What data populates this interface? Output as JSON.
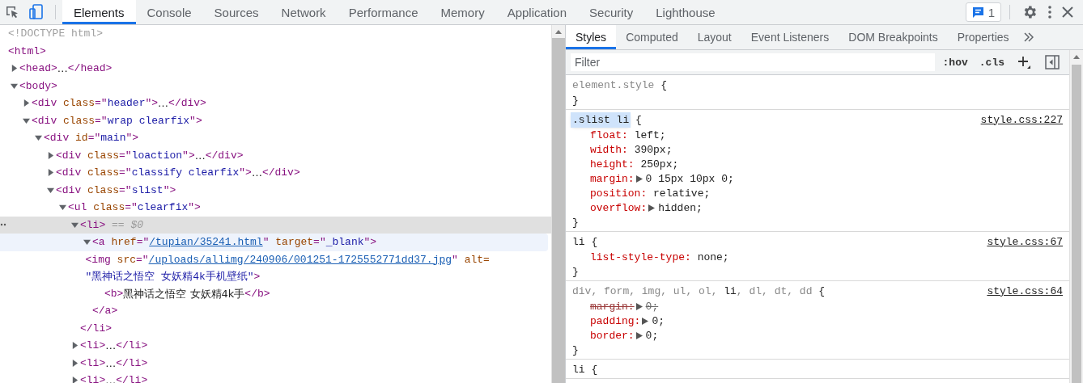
{
  "toolbar": {
    "tabs": [
      {
        "label": "Elements",
        "selected": true
      },
      {
        "label": "Console",
        "selected": false
      },
      {
        "label": "Sources",
        "selected": false
      },
      {
        "label": "Network",
        "selected": false
      },
      {
        "label": "Performance",
        "selected": false
      },
      {
        "label": "Memory",
        "selected": false
      },
      {
        "label": "Application",
        "selected": false
      },
      {
        "label": "Security",
        "selected": false
      },
      {
        "label": "Lighthouse",
        "selected": false
      }
    ],
    "issues_count": "1"
  },
  "dom_tree": [
    {
      "selected": false,
      "hovered": false,
      "segments": [
        {
          "kind": "doctype",
          "text": "<!DOCTYPE html>"
        }
      ]
    },
    {
      "selected": false,
      "hovered": false,
      "segments": [
        {
          "kind": "tag",
          "text": "<html>"
        }
      ],
      "children": [
        {
          "selected": false,
          "hovered": false,
          "expanded": false,
          "segments": [
            {
              "kind": "tag",
              "text": "<head>"
            },
            {
              "kind": "text",
              "text": "…"
            },
            {
              "kind": "tag",
              "text": "</head>"
            }
          ]
        },
        {
          "selected": false,
          "hovered": false,
          "expanded": true,
          "segments": [
            {
              "kind": "tag",
              "text": "<body>"
            }
          ],
          "children": [
            {
              "selected": false,
              "hovered": false,
              "expanded": false,
              "segments": [
                {
                  "kind": "tag",
                  "text": "<div"
                },
                {
                  "kind": "attr",
                  "text": " class"
                },
                {
                  "kind": "punct",
                  "text": "=\""
                },
                {
                  "kind": "value",
                  "text": "header"
                },
                {
                  "kind": "punct",
                  "text": "\""
                },
                {
                  "kind": "tag",
                  "text": ">"
                },
                {
                  "kind": "text",
                  "text": "…"
                },
                {
                  "kind": "tag",
                  "text": "</div>"
                }
              ]
            },
            {
              "selected": false,
              "hovered": false,
              "expanded": true,
              "segments": [
                {
                  "kind": "tag",
                  "text": "<div"
                },
                {
                  "kind": "attr",
                  "text": " class"
                },
                {
                  "kind": "punct",
                  "text": "=\""
                },
                {
                  "kind": "value",
                  "text": "wrap clearfix"
                },
                {
                  "kind": "punct",
                  "text": "\""
                },
                {
                  "kind": "tag",
                  "text": ">"
                }
              ],
              "children": [
                {
                  "selected": false,
                  "hovered": false,
                  "expanded": true,
                  "segments": [
                    {
                      "kind": "tag",
                      "text": "<div"
                    },
                    {
                      "kind": "attr",
                      "text": " id"
                    },
                    {
                      "kind": "punct",
                      "text": "=\""
                    },
                    {
                      "kind": "value",
                      "text": "main"
                    },
                    {
                      "kind": "punct",
                      "text": "\""
                    },
                    {
                      "kind": "tag",
                      "text": ">"
                    }
                  ],
                  "children": [
                    {
                      "selected": false,
                      "hovered": false,
                      "expanded": false,
                      "segments": [
                        {
                          "kind": "tag",
                          "text": "<div"
                        },
                        {
                          "kind": "attr",
                          "text": " class"
                        },
                        {
                          "kind": "punct",
                          "text": "=\""
                        },
                        {
                          "kind": "value",
                          "text": "loaction"
                        },
                        {
                          "kind": "punct",
                          "text": "\""
                        },
                        {
                          "kind": "tag",
                          "text": ">"
                        },
                        {
                          "kind": "text",
                          "text": "…"
                        },
                        {
                          "kind": "tag",
                          "text": "</div>"
                        }
                      ]
                    },
                    {
                      "selected": false,
                      "hovered": false,
                      "expanded": false,
                      "segments": [
                        {
                          "kind": "tag",
                          "text": "<div"
                        },
                        {
                          "kind": "attr",
                          "text": " class"
                        },
                        {
                          "kind": "punct",
                          "text": "=\""
                        },
                        {
                          "kind": "value",
                          "text": "classify clearfix"
                        },
                        {
                          "kind": "punct",
                          "text": "\""
                        },
                        {
                          "kind": "tag",
                          "text": ">"
                        },
                        {
                          "kind": "text",
                          "text": "…"
                        },
                        {
                          "kind": "tag",
                          "text": "</div>"
                        }
                      ]
                    },
                    {
                      "selected": false,
                      "hovered": false,
                      "expanded": true,
                      "segments": [
                        {
                          "kind": "tag",
                          "text": "<div"
                        },
                        {
                          "kind": "attr",
                          "text": " class"
                        },
                        {
                          "kind": "punct",
                          "text": "=\""
                        },
                        {
                          "kind": "value",
                          "text": "slist"
                        },
                        {
                          "kind": "punct",
                          "text": "\""
                        },
                        {
                          "kind": "tag",
                          "text": ">"
                        }
                      ],
                      "children": [
                        {
                          "selected": false,
                          "hovered": false,
                          "expanded": true,
                          "segments": [
                            {
                              "kind": "tag",
                              "text": "<ul"
                            },
                            {
                              "kind": "attr",
                              "text": " class"
                            },
                            {
                              "kind": "punct",
                              "text": "=\""
                            },
                            {
                              "kind": "value",
                              "text": "clearfix"
                            },
                            {
                              "kind": "punct",
                              "text": "\""
                            },
                            {
                              "kind": "tag",
                              "text": ">"
                            }
                          ],
                          "children": [
                            {
                              "selected": true,
                              "hovered": false,
                              "expanded": true,
                              "segments": [
                                {
                                  "kind": "tag",
                                  "text": "<li>"
                                },
                                {
                                  "kind": "marker",
                                  "text": " == $0"
                                }
                              ],
                              "close": [
                                {
                                  "kind": "tag",
                                  "text": "</li>"
                                }
                              ],
                              "children": [
                                {
                                  "selected": false,
                                  "hovered": true,
                                  "expanded": true,
                                  "segments": [
                                    {
                                      "kind": "tag",
                                      "text": "<a"
                                    },
                                    {
                                      "kind": "attr",
                                      "text": " href"
                                    },
                                    {
                                      "kind": "punct",
                                      "text": "=\""
                                    },
                                    {
                                      "kind": "link",
                                      "text": "/tupian/35241.html"
                                    },
                                    {
                                      "kind": "punct",
                                      "text": "\""
                                    },
                                    {
                                      "kind": "attr",
                                      "text": " target"
                                    },
                                    {
                                      "kind": "punct",
                                      "text": "=\""
                                    },
                                    {
                                      "kind": "value",
                                      "text": "_blank"
                                    },
                                    {
                                      "kind": "punct",
                                      "text": "\""
                                    },
                                    {
                                      "kind": "tag",
                                      "text": ">"
                                    }
                                  ],
                                  "close": [
                                    {
                                      "kind": "tag",
                                      "text": "</a>"
                                    }
                                  ],
                                  "children": [
                                    {
                                      "selected": false,
                                      "hovered": false,
                                      "segments": [
                                        {
                                          "kind": "tag",
                                          "text": "<img"
                                        },
                                        {
                                          "kind": "attr",
                                          "text": " src"
                                        },
                                        {
                                          "kind": "punct",
                                          "text": "=\""
                                        },
                                        {
                                          "kind": "link",
                                          "text": "/uploads/allimg/240906/001251-1725552771dd37.jpg"
                                        },
                                        {
                                          "kind": "punct",
                                          "text": "\""
                                        },
                                        {
                                          "kind": "attr",
                                          "text": " alt="
                                        },
                                        {
                                          "kind": "value",
                                          "text": "\"黑神话之悟空 女妖精4k手机壁纸\""
                                        },
                                        {
                                          "kind": "tag",
                                          "text": ">"
                                        }
                                      ]
                                    },
                                    {
                                      "selected": false,
                                      "hovered": false,
                                      "segments": [
                                        {
                                          "kind": "tag",
                                          "text": "<b>"
                                        },
                                        {
                                          "kind": "text",
                                          "text": "黑神话之悟空 女妖精4k手"
                                        },
                                        {
                                          "kind": "tag",
                                          "text": "</b>"
                                        }
                                      ]
                                    }
                                  ]
                                }
                              ]
                            },
                            {
                              "selected": false,
                              "hovered": false,
                              "expanded": false,
                              "segments": [
                                {
                                  "kind": "tag",
                                  "text": "<li>"
                                },
                                {
                                  "kind": "text",
                                  "text": "…"
                                },
                                {
                                  "kind": "tag",
                                  "text": "</li>"
                                }
                              ]
                            },
                            {
                              "selected": false,
                              "hovered": false,
                              "expanded": false,
                              "segments": [
                                {
                                  "kind": "tag",
                                  "text": "<li>"
                                },
                                {
                                  "kind": "text",
                                  "text": "…"
                                },
                                {
                                  "kind": "tag",
                                  "text": "</li>"
                                }
                              ]
                            },
                            {
                              "selected": false,
                              "hovered": false,
                              "expanded": false,
                              "segments": [
                                {
                                  "kind": "tag",
                                  "text": "<li>"
                                },
                                {
                                  "kind": "text",
                                  "text": "…"
                                },
                                {
                                  "kind": "tag",
                                  "text": "</li>"
                                }
                              ]
                            }
                          ]
                        }
                      ]
                    }
                  ]
                }
              ]
            }
          ]
        }
      ]
    }
  ],
  "styles_pane": {
    "tabs": [
      {
        "label": "Styles",
        "selected": true
      },
      {
        "label": "Computed",
        "selected": false
      },
      {
        "label": "Layout",
        "selected": false
      },
      {
        "label": "Event Listeners",
        "selected": false
      },
      {
        "label": "DOM Breakpoints",
        "selected": false
      },
      {
        "label": "Properties",
        "selected": false
      }
    ],
    "filter": {
      "placeholder": "Filter"
    },
    "hov_label": ":hov",
    "cls_label": ".cls",
    "rules": [
      {
        "highlighted": false,
        "selector_parts": [
          {
            "text": "element.style",
            "matched": false
          }
        ],
        "open": " {",
        "close": "}"
      },
      {
        "highlighted": true,
        "selector_parts": [
          {
            "text": ".slist li",
            "matched": true
          }
        ],
        "open": " {",
        "close": "}",
        "source": "style.css:227",
        "declarations": [
          {
            "property": "float:",
            "value": "left;",
            "expandable": false,
            "overridden": false
          },
          {
            "property": "width:",
            "value": "390px;",
            "expandable": false,
            "overridden": false
          },
          {
            "property": "height:",
            "value": "250px;",
            "expandable": false,
            "overridden": false
          },
          {
            "property": "margin:",
            "value": "0 15px 10px 0;",
            "expandable": true,
            "overridden": false
          },
          {
            "property": "position:",
            "value": "relative;",
            "expandable": false,
            "overridden": false
          },
          {
            "property": "overflow:",
            "value": "hidden;",
            "expandable": true,
            "overridden": false
          }
        ]
      },
      {
        "highlighted": false,
        "selector_parts": [
          {
            "text": "li",
            "matched": true
          }
        ],
        "open": " {",
        "close": "}",
        "source": "style.css:67",
        "declarations": [
          {
            "property": "list-style-type:",
            "value": "none;",
            "expandable": false,
            "overridden": false
          }
        ]
      },
      {
        "highlighted": false,
        "selector_parts": [
          {
            "text": "div, form, img, ul, ol, ",
            "matched": false
          },
          {
            "text": "li",
            "matched": true
          },
          {
            "text": ", dl, dt, dd",
            "matched": false
          }
        ],
        "open": " {",
        "close": "}",
        "source": "style.css:64",
        "declarations": [
          {
            "property": "margin:",
            "value": "0;",
            "expandable": true,
            "overridden": true
          },
          {
            "property": "padding:",
            "value": "0;",
            "expandable": true,
            "overridden": false
          },
          {
            "property": "border:",
            "value": "0;",
            "expandable": true,
            "overridden": false
          }
        ]
      },
      {
        "highlighted": false,
        "selector_parts": [
          {
            "text": "li",
            "matched": true
          }
        ],
        "open": " {"
      }
    ]
  }
}
